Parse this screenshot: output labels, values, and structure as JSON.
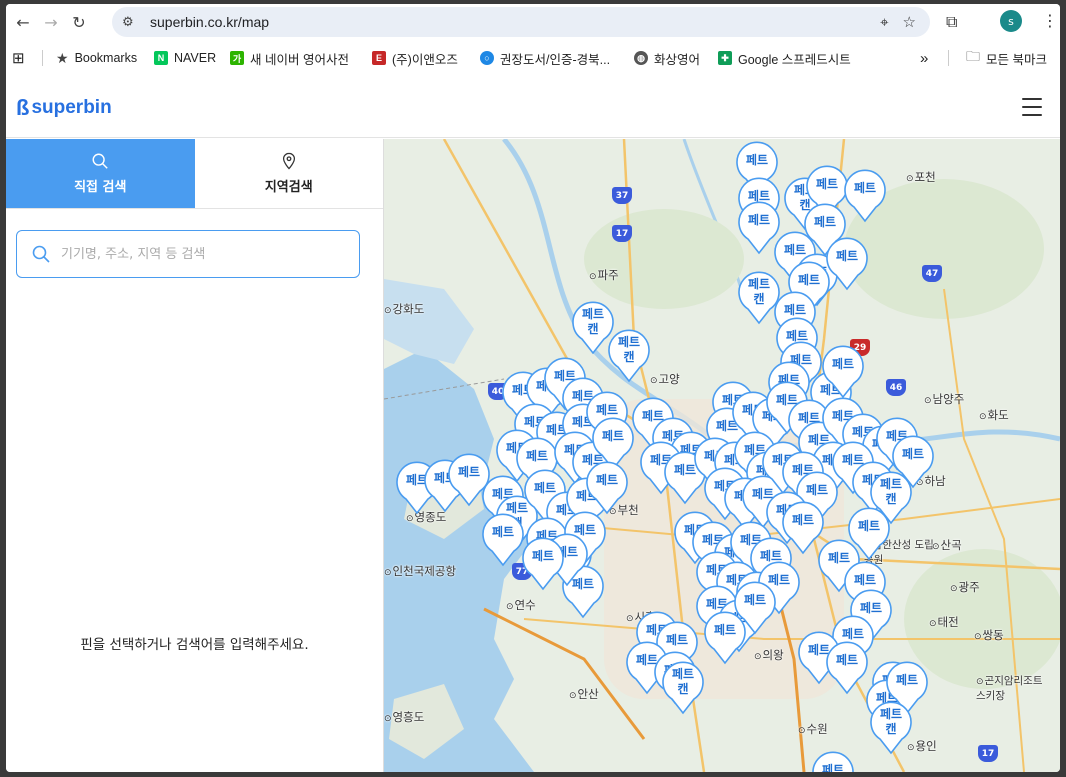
{
  "browser": {
    "url": "superbin.co.kr/map",
    "profile_initial": "s",
    "bookmarks": [
      {
        "label": "Bookmarks",
        "icon": "star-icon",
        "color": "#444444"
      },
      {
        "label": "NAVER",
        "icon": "naver-icon",
        "color": "#03c75a"
      },
      {
        "label": "새 네이버 영어사전",
        "icon": "naver-dict-icon",
        "color": "#2db400"
      },
      {
        "label": "(주)이앤오즈",
        "icon": "company-icon",
        "color": "#c62828"
      },
      {
        "label": "권장도서/인증-경북...",
        "icon": "book-cert-icon",
        "color": "#1e88e5"
      },
      {
        "label": "화상영어",
        "icon": "globe-icon",
        "color": "#555555"
      },
      {
        "label": "Google 스프레드시트",
        "icon": "sheets-icon",
        "color": "#0f9d58"
      }
    ],
    "more_bookmarks": "»",
    "all_bookmarks": "모든 북마크"
  },
  "app": {
    "logo": "superbin",
    "brand_color": "#2770e0",
    "tabs": {
      "direct_search": "직접 검색",
      "region_search": "지역검색"
    },
    "search": {
      "value": "",
      "placeholder": "기기명, 주소, 지역 등 검색"
    },
    "empty_message": "핀을 선택하거나 검색어를 입력해주세요."
  },
  "map": {
    "pin_label_1": "페트",
    "pin_label_2": "페트\n캔",
    "pin_color": "#4a9cf0",
    "places": [
      "포천",
      "파주",
      "고양",
      "남양주",
      "화도",
      "하남",
      "부천",
      "광주",
      "용인",
      "수원",
      "의왕",
      "안산",
      "시흥",
      "연수",
      "인천국제공항",
      "영흥도",
      "남한산성 도립공원",
      "곤지암리조트 스키장",
      "강화도",
      "영종도",
      "쌍동",
      "산곡",
      "태전"
    ],
    "routes": [
      "37",
      "17",
      "47",
      "29",
      "46",
      "40",
      "77",
      "17"
    ]
  }
}
